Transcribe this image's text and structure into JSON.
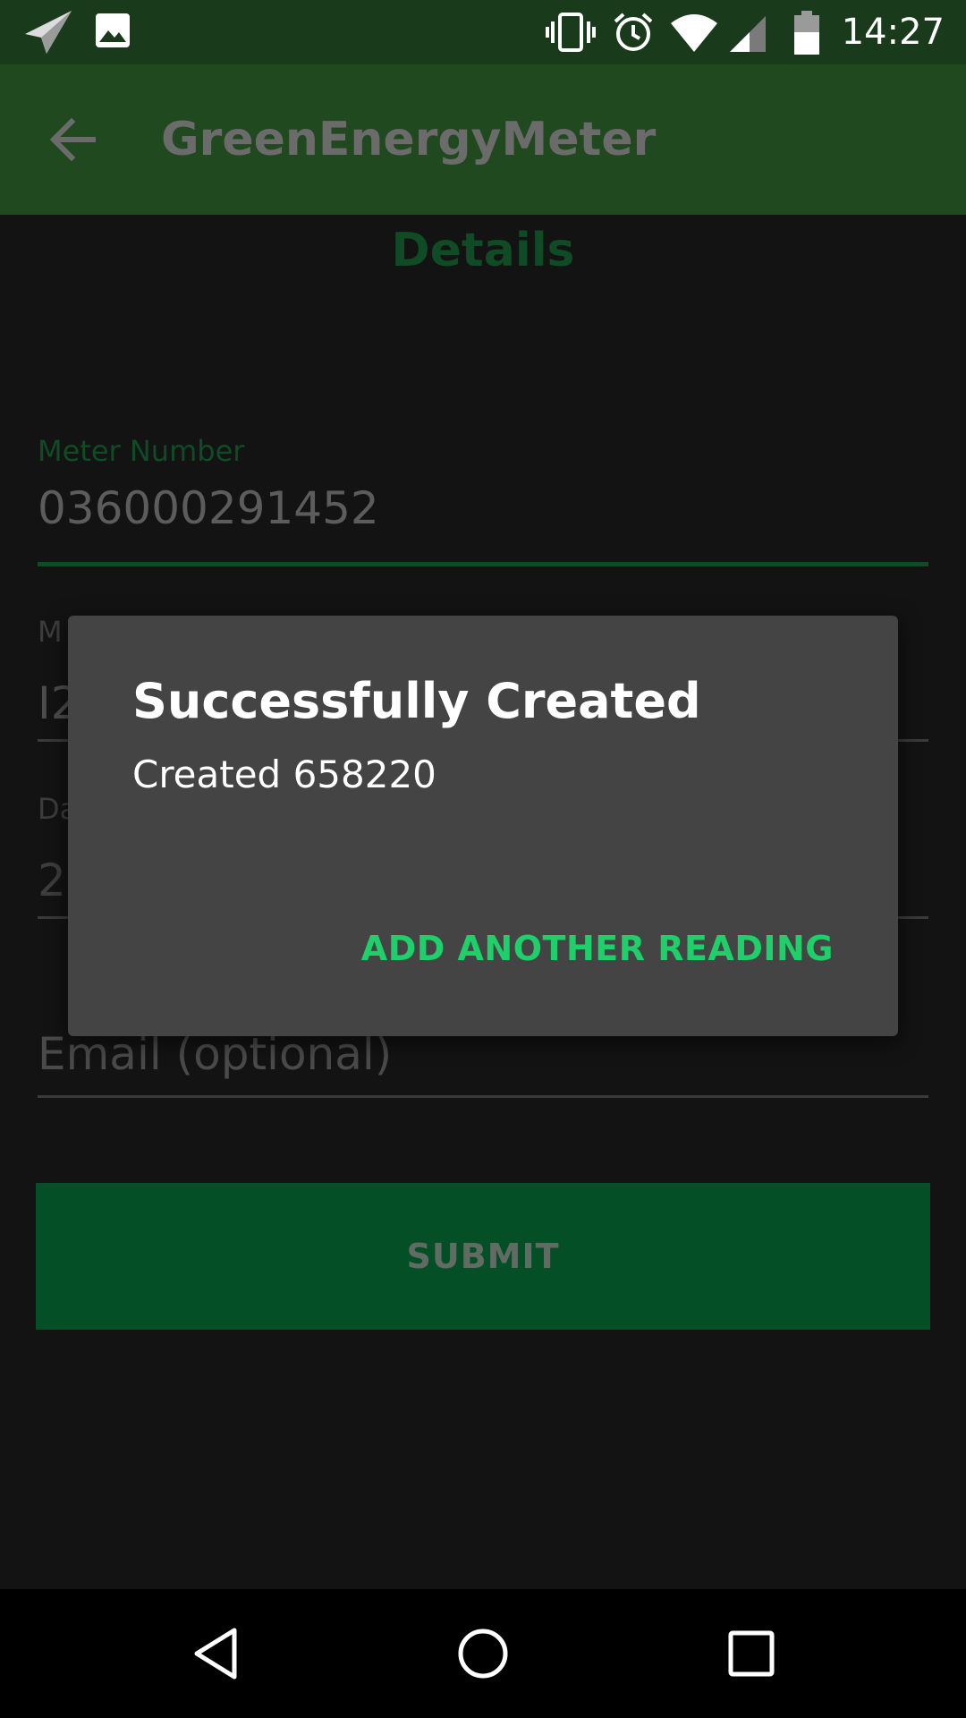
{
  "status_bar": {
    "time": "14:27",
    "left_icons": [
      "send-icon",
      "image-icon"
    ],
    "right_icons": [
      "vibrate-icon",
      "alarm-icon",
      "wifi-icon",
      "signal-icon",
      "battery-icon"
    ]
  },
  "app_bar": {
    "title": "GreenEnergyMeter",
    "back_icon": "arrow-left-icon"
  },
  "page": {
    "heading": "Details"
  },
  "form": {
    "meter_number": {
      "label": "Meter Number",
      "value": "036000291452"
    },
    "second_field": {
      "label": "M",
      "value": "I2"
    },
    "date_field": {
      "label": "Da",
      "value": "2"
    },
    "email_field": {
      "placeholder": "Email (optional)"
    },
    "submit_label": "SUBMIT"
  },
  "dialog": {
    "title": "Successfully Created",
    "message": "Created 658220",
    "action_label": "ADD ANOTHER READING"
  },
  "nav_bar": {
    "icons": [
      "back-triangle-icon",
      "home-circle-icon",
      "recents-square-icon"
    ]
  },
  "colors": {
    "accent_green": "#1fd06a",
    "app_bar": "#21491f",
    "submit_bg": "#044f26"
  }
}
